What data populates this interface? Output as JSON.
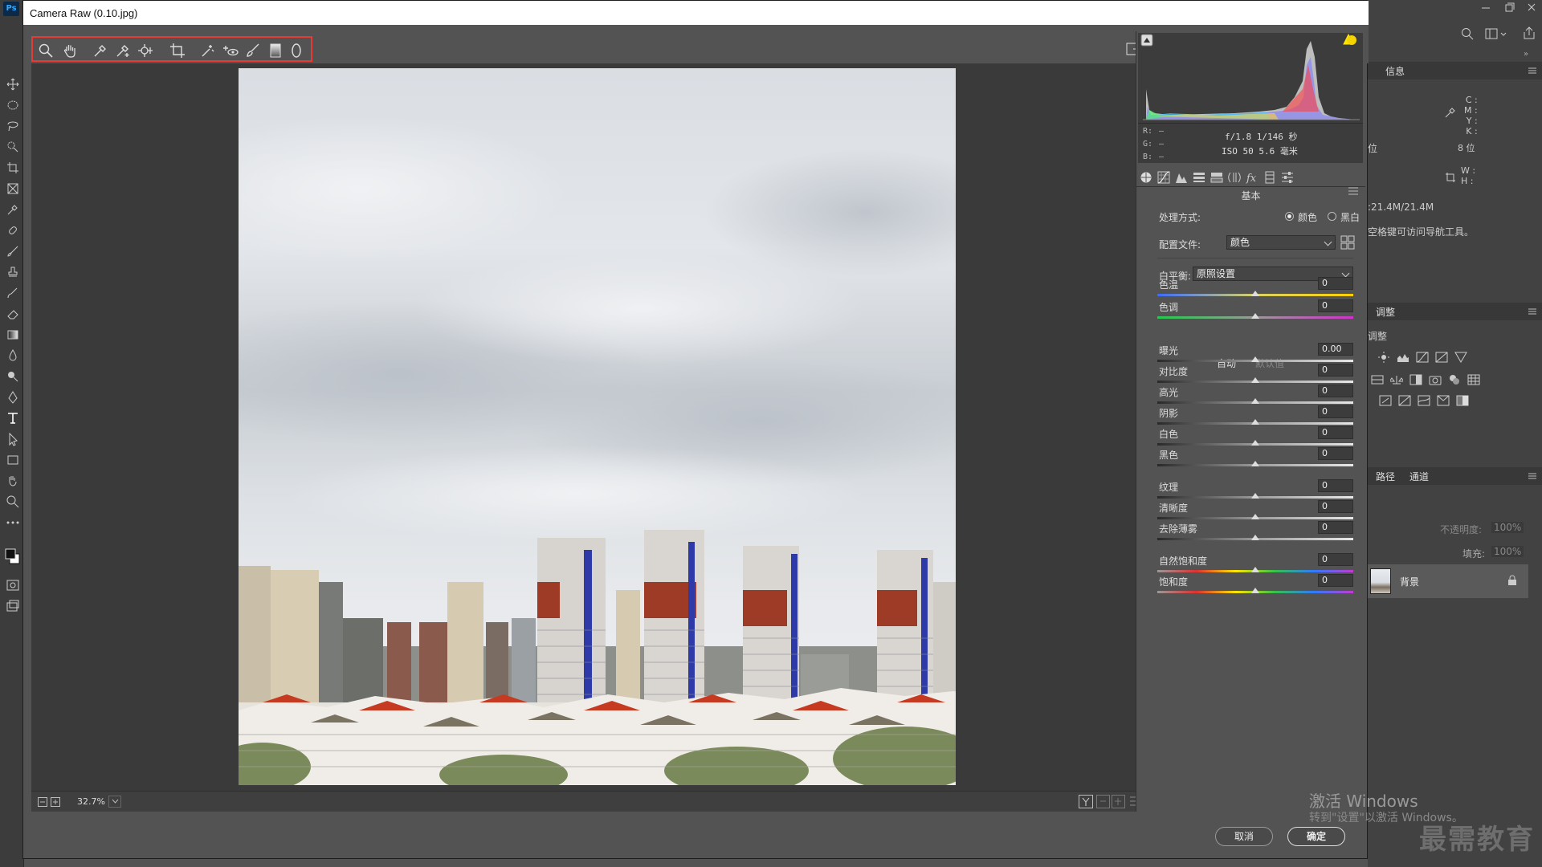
{
  "app": {
    "logo": "Ps",
    "dialog_title": "Camera Raw (0.10.jpg)"
  },
  "ps_right_panel": {
    "info_tab": "信息",
    "info_cmyk": "C :\nM :\nY :\nK :",
    "info_bits": "8 位",
    "info_wh": "W :\nH :",
    "doc_size": ":21.4M/21.4M",
    "hint": "空格键可访问导航工具。",
    "adjust_tab": "调整",
    "adjust_sub": "调整",
    "paths_tab": "路径",
    "channels_tab": "通道",
    "opacity_label": "不透明度:",
    "opacity_value": "100%",
    "fill_label": "填充:",
    "fill_value": "100%",
    "layer_name": "背景",
    "left_partial": "位"
  },
  "readout": {
    "r": "R:",
    "g": "G:",
    "b": "B:",
    "dash": "—",
    "exif_line1": "f/1.8   1/146 秒",
    "exif_line2": "ISO 50   5.6 毫米"
  },
  "basic": {
    "section_title": "基本",
    "treatment_label": "处理方式:",
    "color_option": "颜色",
    "bw_option": "黑白",
    "treatment_selected": "颜色",
    "profile_label": "配置文件:",
    "profile_value": "颜色",
    "wb_label": "白平衡:",
    "wb_value": "原照设置",
    "auto_link": "自动",
    "default_link": "默认值",
    "sliders": [
      {
        "label": "色温",
        "value": "0"
      },
      {
        "label": "色调",
        "value": "0"
      },
      {
        "label": "曝光",
        "value": "0.00"
      },
      {
        "label": "对比度",
        "value": "0"
      },
      {
        "label": "高光",
        "value": "0"
      },
      {
        "label": "阴影",
        "value": "0"
      },
      {
        "label": "白色",
        "value": "0"
      },
      {
        "label": "黑色",
        "value": "0"
      },
      {
        "label": "纹理",
        "value": "0"
      },
      {
        "label": "清晰度",
        "value": "0"
      },
      {
        "label": "去除薄雾",
        "value": "0"
      },
      {
        "label": "自然饱和度",
        "value": "0"
      },
      {
        "label": "饱和度",
        "value": "0"
      }
    ]
  },
  "footer": {
    "zoom": "32.7%",
    "cancel": "取消",
    "ok": "确定"
  },
  "watermark": {
    "line1": "激活 Windows",
    "line2": "转到\"设置\"以激活 Windows。",
    "brand": "最需教育"
  }
}
